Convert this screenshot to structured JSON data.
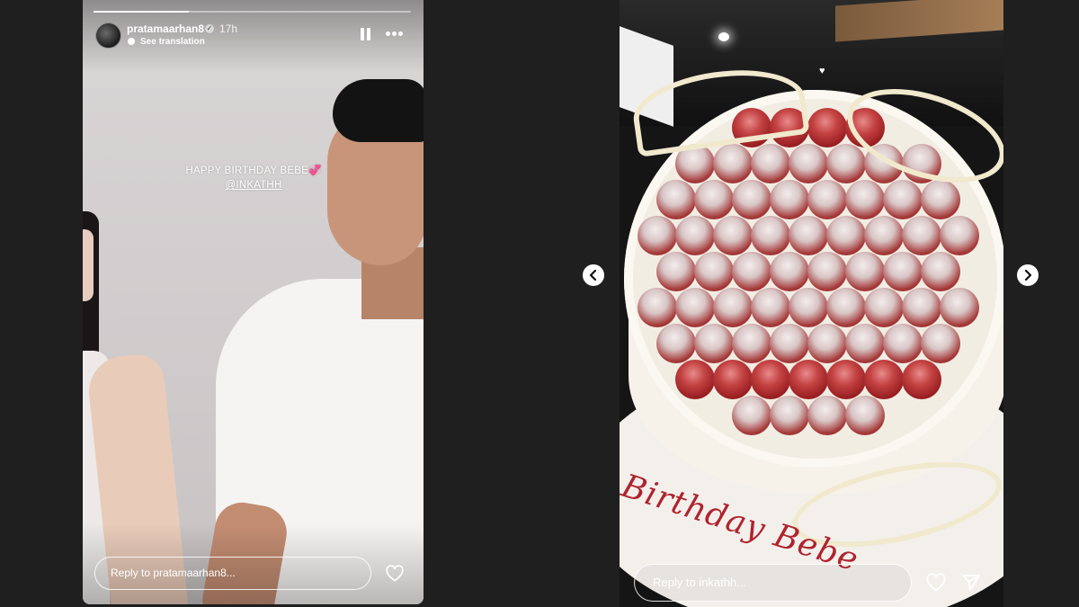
{
  "left_story": {
    "username": "pratamaarhan8",
    "timestamp": "17h",
    "see_translation": "See translation",
    "progress_fraction": 0.3,
    "caption_line1": "HAPPY BIRTHDAY BEBE",
    "caption_emoji": "💞",
    "caption_mention": "@INKATHH",
    "reply_placeholder": "Reply to pratamaarhan8..."
  },
  "right_story": {
    "cake_text": "Birthday Bebe",
    "reply_placeholder": "Reply to inkathh..."
  },
  "icons": {
    "verified": "verified-badge-icon",
    "pause": "pause-icon",
    "more": "more-options-icon",
    "heart": "heart-icon",
    "send": "send-icon",
    "prev": "chevron-left-icon",
    "next": "chevron-right-icon"
  },
  "colors": {
    "background": "#1f1f1f",
    "accent_white": "#ffffff",
    "emoji_pink": "#e8579d",
    "cake_writing": "#b0232d"
  }
}
